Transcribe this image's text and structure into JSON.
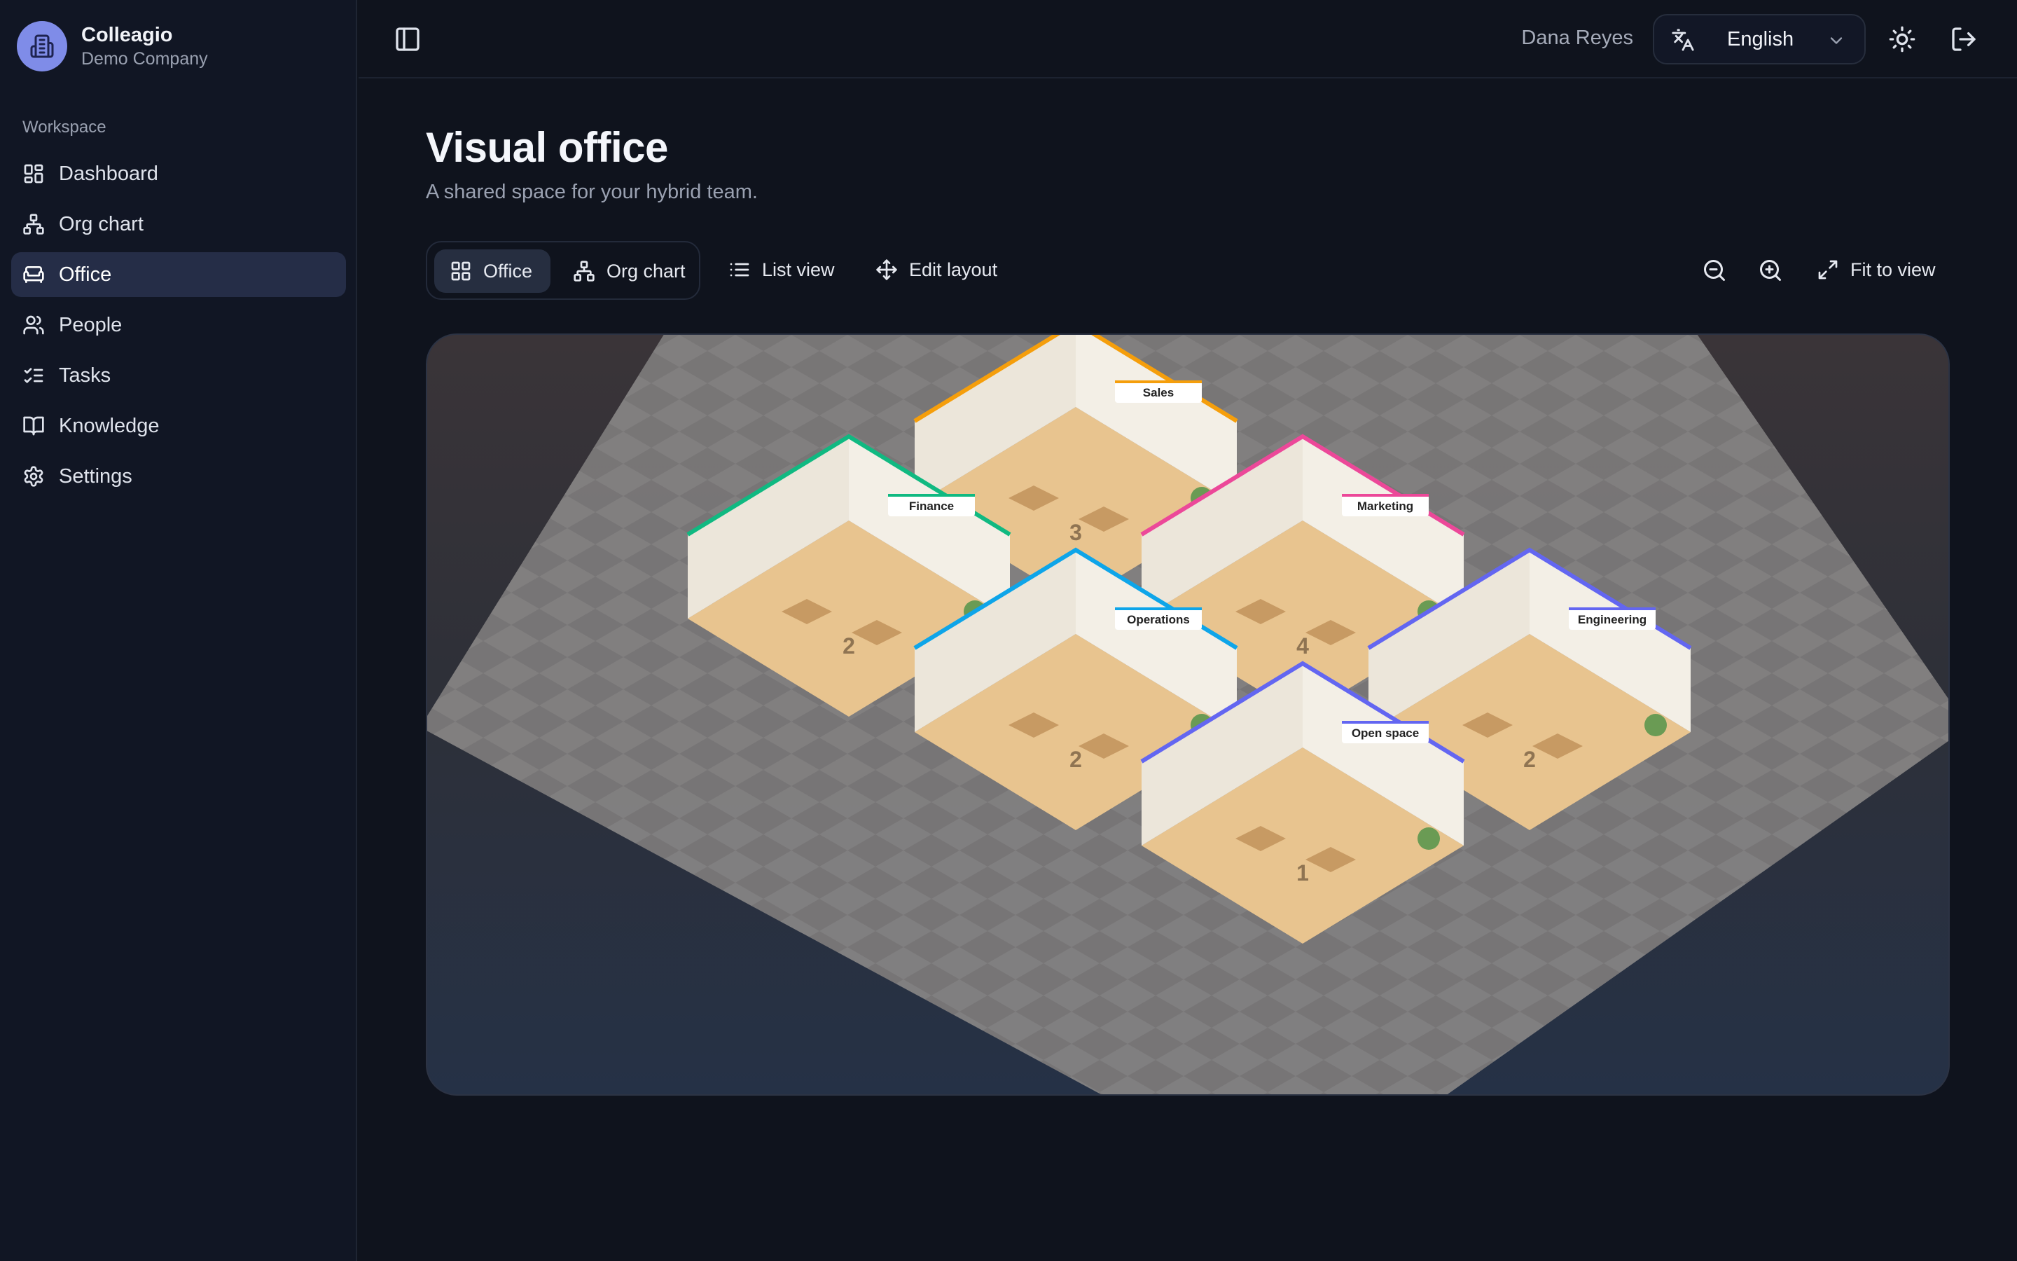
{
  "brand": {
    "name": "Colleagio",
    "company": "Demo Company"
  },
  "sidebar": {
    "section_label": "Workspace",
    "items": [
      {
        "label": "Dashboard",
        "icon": "dashboard-icon",
        "active": false
      },
      {
        "label": "Org chart",
        "icon": "org-chart-icon",
        "active": false
      },
      {
        "label": "Office",
        "icon": "sofa-icon",
        "active": true
      },
      {
        "label": "People",
        "icon": "people-icon",
        "active": false
      },
      {
        "label": "Tasks",
        "icon": "tasks-icon",
        "active": false
      },
      {
        "label": "Knowledge",
        "icon": "book-icon",
        "active": false
      },
      {
        "label": "Settings",
        "icon": "gear-icon",
        "active": false
      }
    ]
  },
  "header": {
    "user_name": "Dana Reyes",
    "language": {
      "selected": "English",
      "icon": "translate-icon"
    },
    "theme_icon": "sun-icon",
    "logout_icon": "logout-icon"
  },
  "main": {
    "title": "Visual office",
    "subtitle": "A shared space for your hybrid team.",
    "view_toggle": [
      {
        "label": "Office",
        "icon": "grid-icon",
        "active": true
      },
      {
        "label": "Org chart",
        "icon": "org-chart-icon",
        "active": false
      }
    ],
    "actions": {
      "list_view": "List view",
      "edit_layout": "Edit layout",
      "fit_to_view": "Fit to view"
    }
  },
  "office": {
    "rooms": [
      {
        "label": "Sales",
        "count": "3",
        "accent": "#f59e0b"
      },
      {
        "label": "Finance",
        "count": "2",
        "accent": "#10b981"
      },
      {
        "label": "Marketing",
        "count": "4",
        "accent": "#ec4899"
      },
      {
        "label": "Operations",
        "count": "2",
        "accent": "#0ea5e9"
      },
      {
        "label": "Engineering",
        "count": "2",
        "accent": "#6366f1"
      },
      {
        "label": "Open space",
        "count": "1",
        "accent": "#6366f1"
      }
    ]
  },
  "colors": {
    "accent": "#7f8ce8",
    "active_nav": "#252d47",
    "background": "#0f131d"
  }
}
